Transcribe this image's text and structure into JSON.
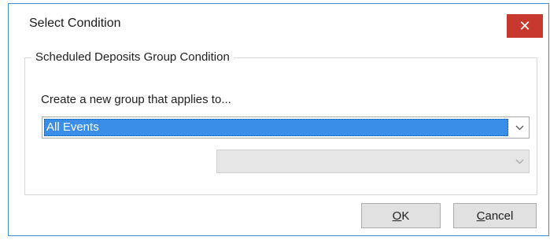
{
  "window": {
    "title": "Select Condition",
    "close_glyph": "✕"
  },
  "group": {
    "legend": "Scheduled Deposits Group Condition",
    "prompt": "Create a new group that applies to...",
    "primary_select": {
      "selected_value": "All Events"
    },
    "secondary_select": {
      "selected_value": ""
    }
  },
  "buttons": {
    "ok": {
      "mnemonic": "O",
      "rest": "K"
    },
    "cancel": {
      "mnemonic": "C",
      "rest": "ancel"
    }
  },
  "colors": {
    "close_button_bg": "#c7392f",
    "selection_highlight": "#3b8ee8",
    "window_border": "#3f8fd8"
  },
  "icons": [
    "close-icon",
    "chevron-down-icon"
  ]
}
